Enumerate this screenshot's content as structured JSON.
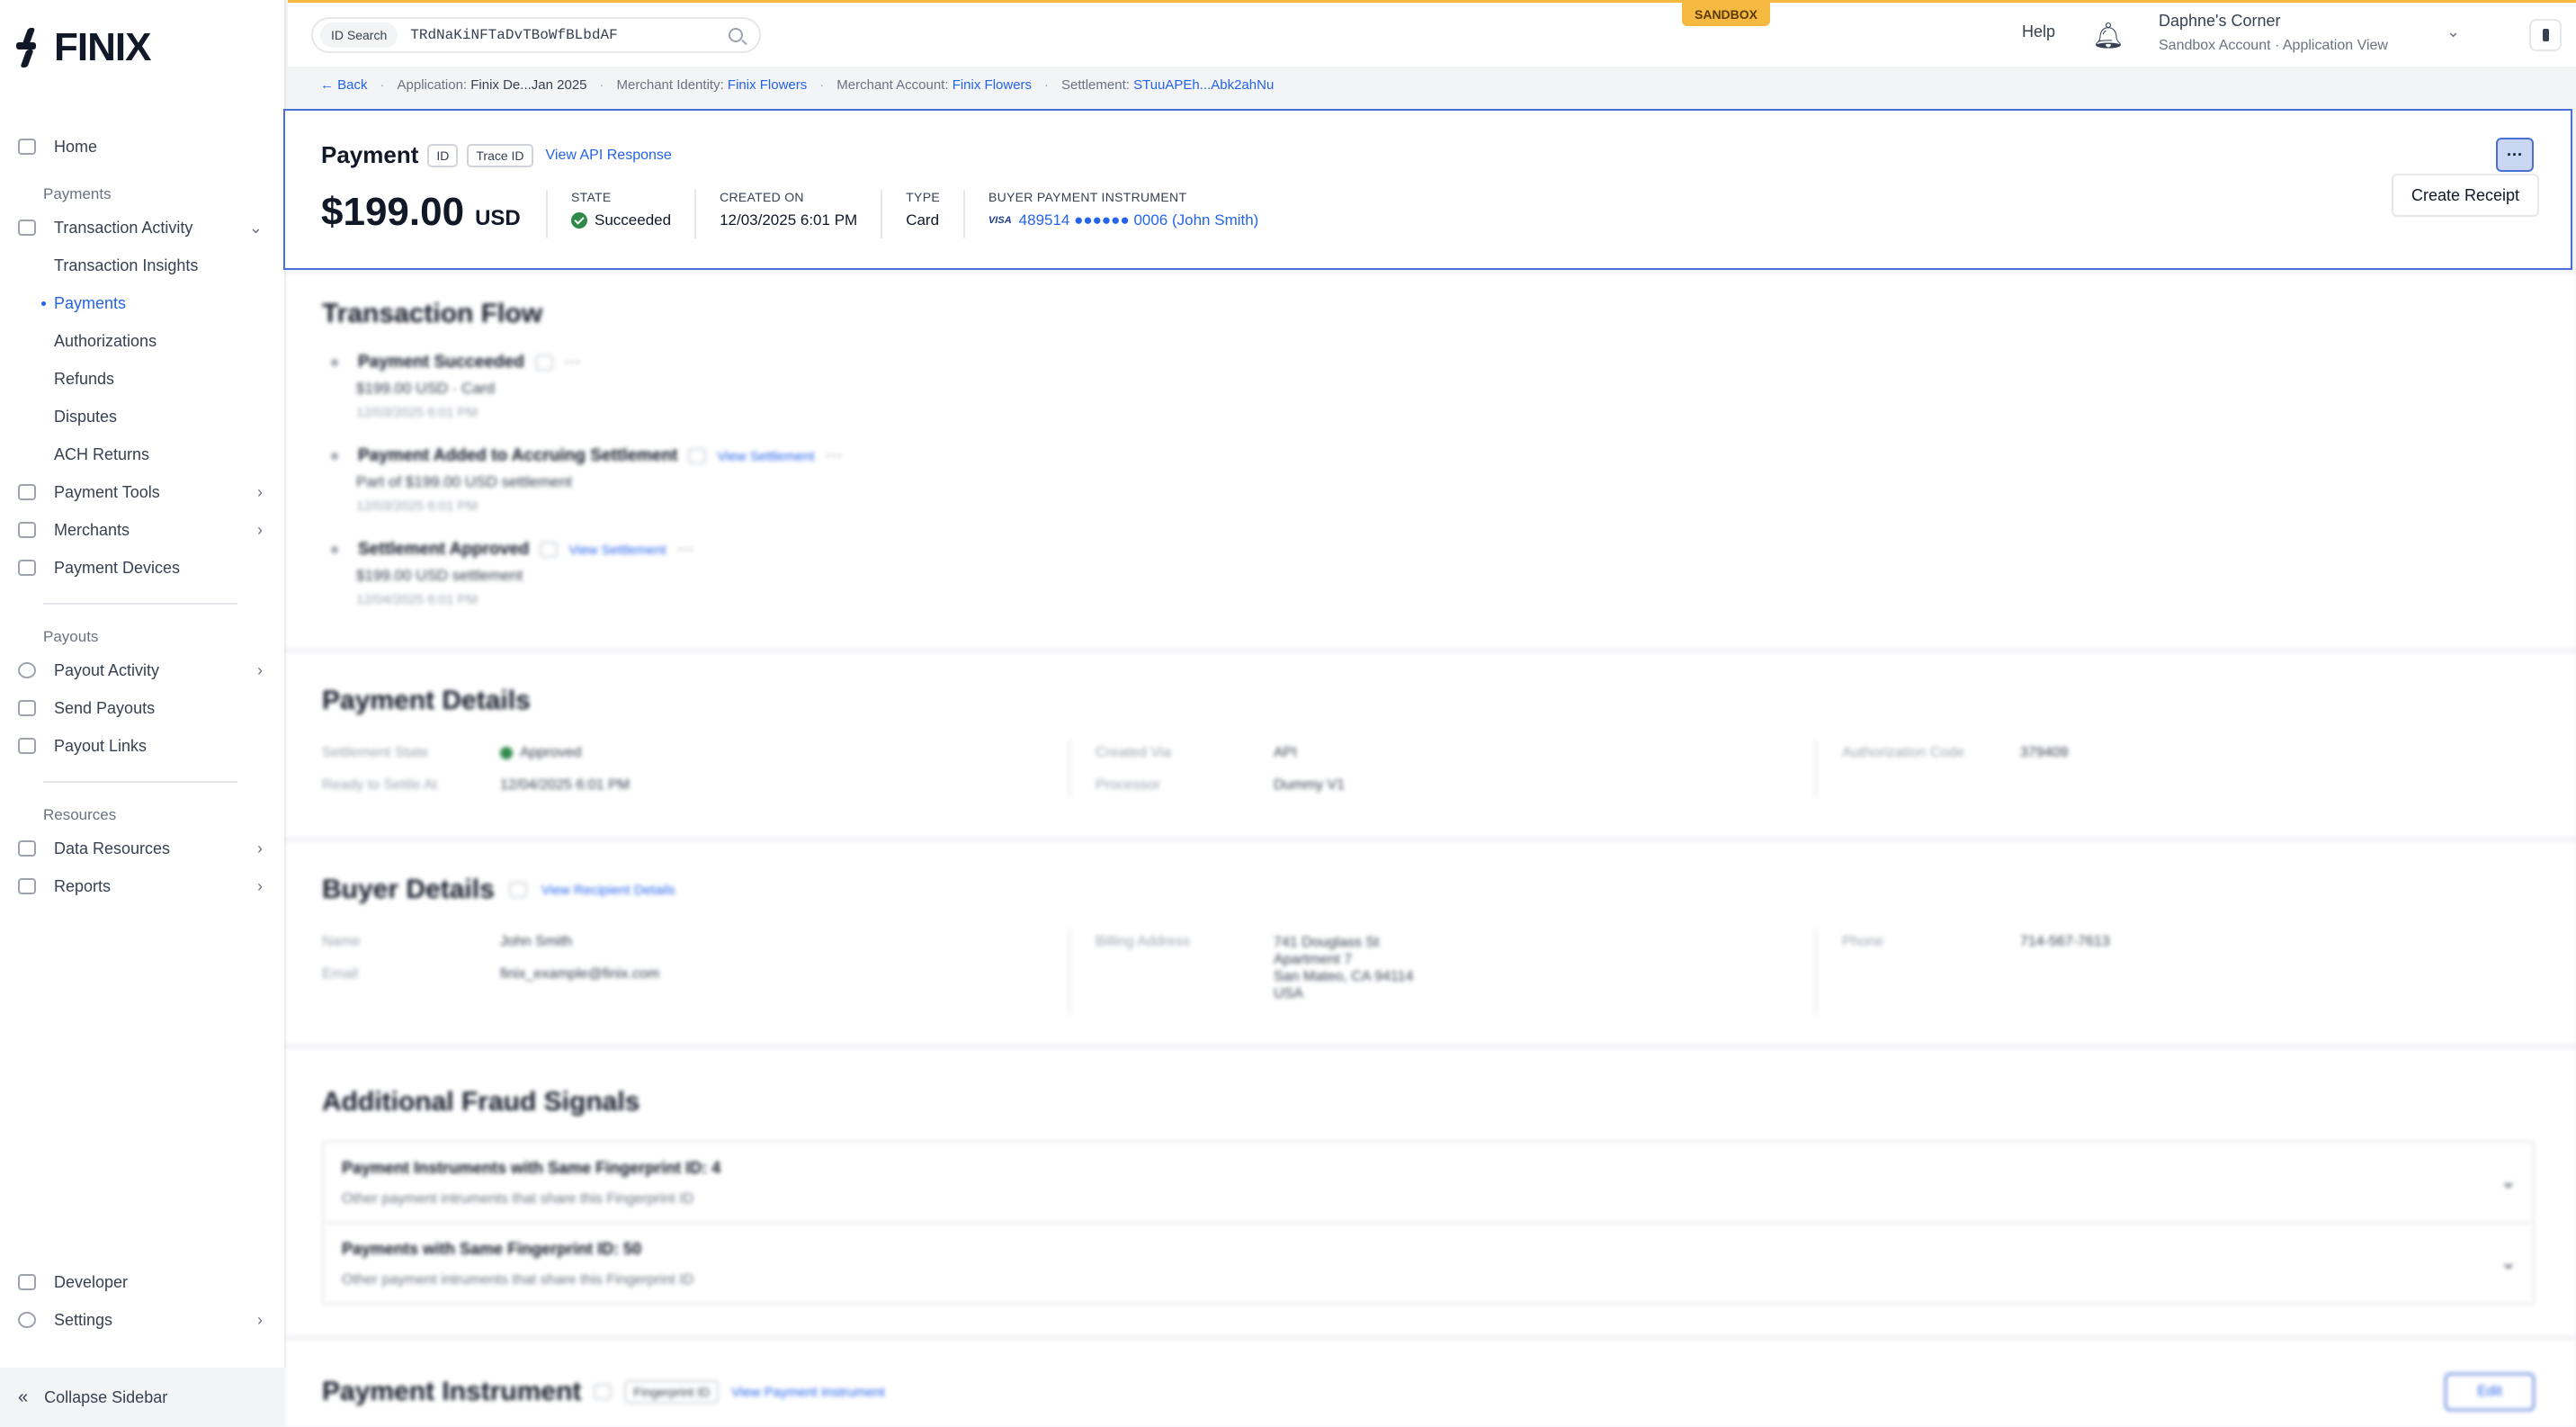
{
  "sidebar": {
    "logo_text": "FINIX",
    "home": "Home",
    "sections": {
      "payments": "Payments",
      "payouts": "Payouts",
      "resources": "Resources"
    },
    "items": {
      "transaction_activity": "Transaction Activity",
      "transaction_insights": "Transaction Insights",
      "payments": "Payments",
      "authorizations": "Authorizations",
      "refunds": "Refunds",
      "disputes": "Disputes",
      "ach_returns": "ACH Returns",
      "payment_tools": "Payment Tools",
      "merchants": "Merchants",
      "payment_devices": "Payment Devices",
      "payout_activity": "Payout Activity",
      "send_payouts": "Send Payouts",
      "payout_links": "Payout Links",
      "data_resources": "Data Resources",
      "reports": "Reports",
      "developer": "Developer",
      "settings": "Settings"
    },
    "collapse": "Collapse Sidebar"
  },
  "topbar": {
    "sandbox_badge": "SANDBOX",
    "search_tag": "ID Search",
    "search_value": "TRdNaKiNFTaDvTBoWfBLbdAF",
    "help": "Help",
    "user_name": "Daphne's Corner",
    "user_context": "Sandbox Account  ·  Application View"
  },
  "breadcrumb": {
    "back": "Back",
    "application_key": "Application:",
    "application_val": "Finix De...Jan 2025",
    "merchant_identity_key": "Merchant Identity:",
    "merchant_identity_val": "Finix Flowers",
    "merchant_account_key": "Merchant Account:",
    "merchant_account_val": "Finix Flowers",
    "settlement_key": "Settlement:",
    "settlement_val": "STuuAPEh...Abk2ahNu"
  },
  "header": {
    "title": "Payment",
    "id_chip": "ID",
    "trace_chip": "Trace ID",
    "api_link": "View API Response",
    "amount": "$199.00",
    "currency": "USD",
    "state_label": "STATE",
    "state_value": "Succeeded",
    "created_label": "CREATED ON",
    "created_value": "12/03/2025 6:01 PM",
    "type_label": "TYPE",
    "type_value": "Card",
    "instrument_label": "BUYER PAYMENT INSTRUMENT",
    "instrument_brand": "VISA",
    "instrument_value": "489514 ●●●●●● 0006 (John Smith)",
    "more_button": "···",
    "receipt_button": "Create Receipt"
  },
  "transaction_flow": {
    "title": "Transaction Flow",
    "steps": [
      {
        "title": "Payment Succeeded",
        "link": "",
        "line": "$199.00 USD  ·  Card",
        "time": "12/03/2025 6:01 PM"
      },
      {
        "title": "Payment Added to Accruing Settlement",
        "link": "View Settlement",
        "line": "Part of $199.00 USD settlement",
        "time": "12/03/2025 6:01 PM"
      },
      {
        "title": "Settlement Approved",
        "link": "View Settlement",
        "line": "$199.00 USD settlement",
        "time": "12/04/2025 6:01 PM"
      }
    ]
  },
  "payment_details": {
    "title": "Payment Details",
    "settlement_state_label": "Settlement State",
    "settlement_state_value": "Approved",
    "ready_label": "Ready to Settle At",
    "ready_value": "12/04/2025 6:01 PM",
    "created_via_label": "Created Via",
    "created_via_value": "API",
    "processor_label": "Processor",
    "processor_value": "Dummy V1",
    "auth_code_label": "Authorization Code",
    "auth_code_value": "379409"
  },
  "buyer_details": {
    "title": "Buyer Details",
    "link": "View Recipient Details",
    "name_label": "Name",
    "name_value": "John Smith",
    "email_label": "Email",
    "email_value": "finix_example@finix.com",
    "billing_label": "Billing Address",
    "billing_line1": "741 Douglass St",
    "billing_line2": "Apartment 7",
    "billing_line3": "San Mateo, CA 94114",
    "billing_line4": "USA",
    "phone_label": "Phone",
    "phone_value": "714-567-7613"
  },
  "fraud_signals": {
    "title": "Additional Fraud Signals",
    "items": [
      {
        "title": "Payment Instruments with Same Fingerprint ID: 4",
        "subtitle": "Other payment intruments that share this Fingerprint ID"
      },
      {
        "title": "Payments with Same Fingerprint ID: 50",
        "subtitle": "Other payment intruments that share this Fingerprint ID"
      }
    ]
  },
  "payment_instrument": {
    "title": "Payment Instrument",
    "fingerprint_chip": "Fingerprint ID",
    "link": "View Payment Instrument",
    "edit_button": "Edit"
  }
}
